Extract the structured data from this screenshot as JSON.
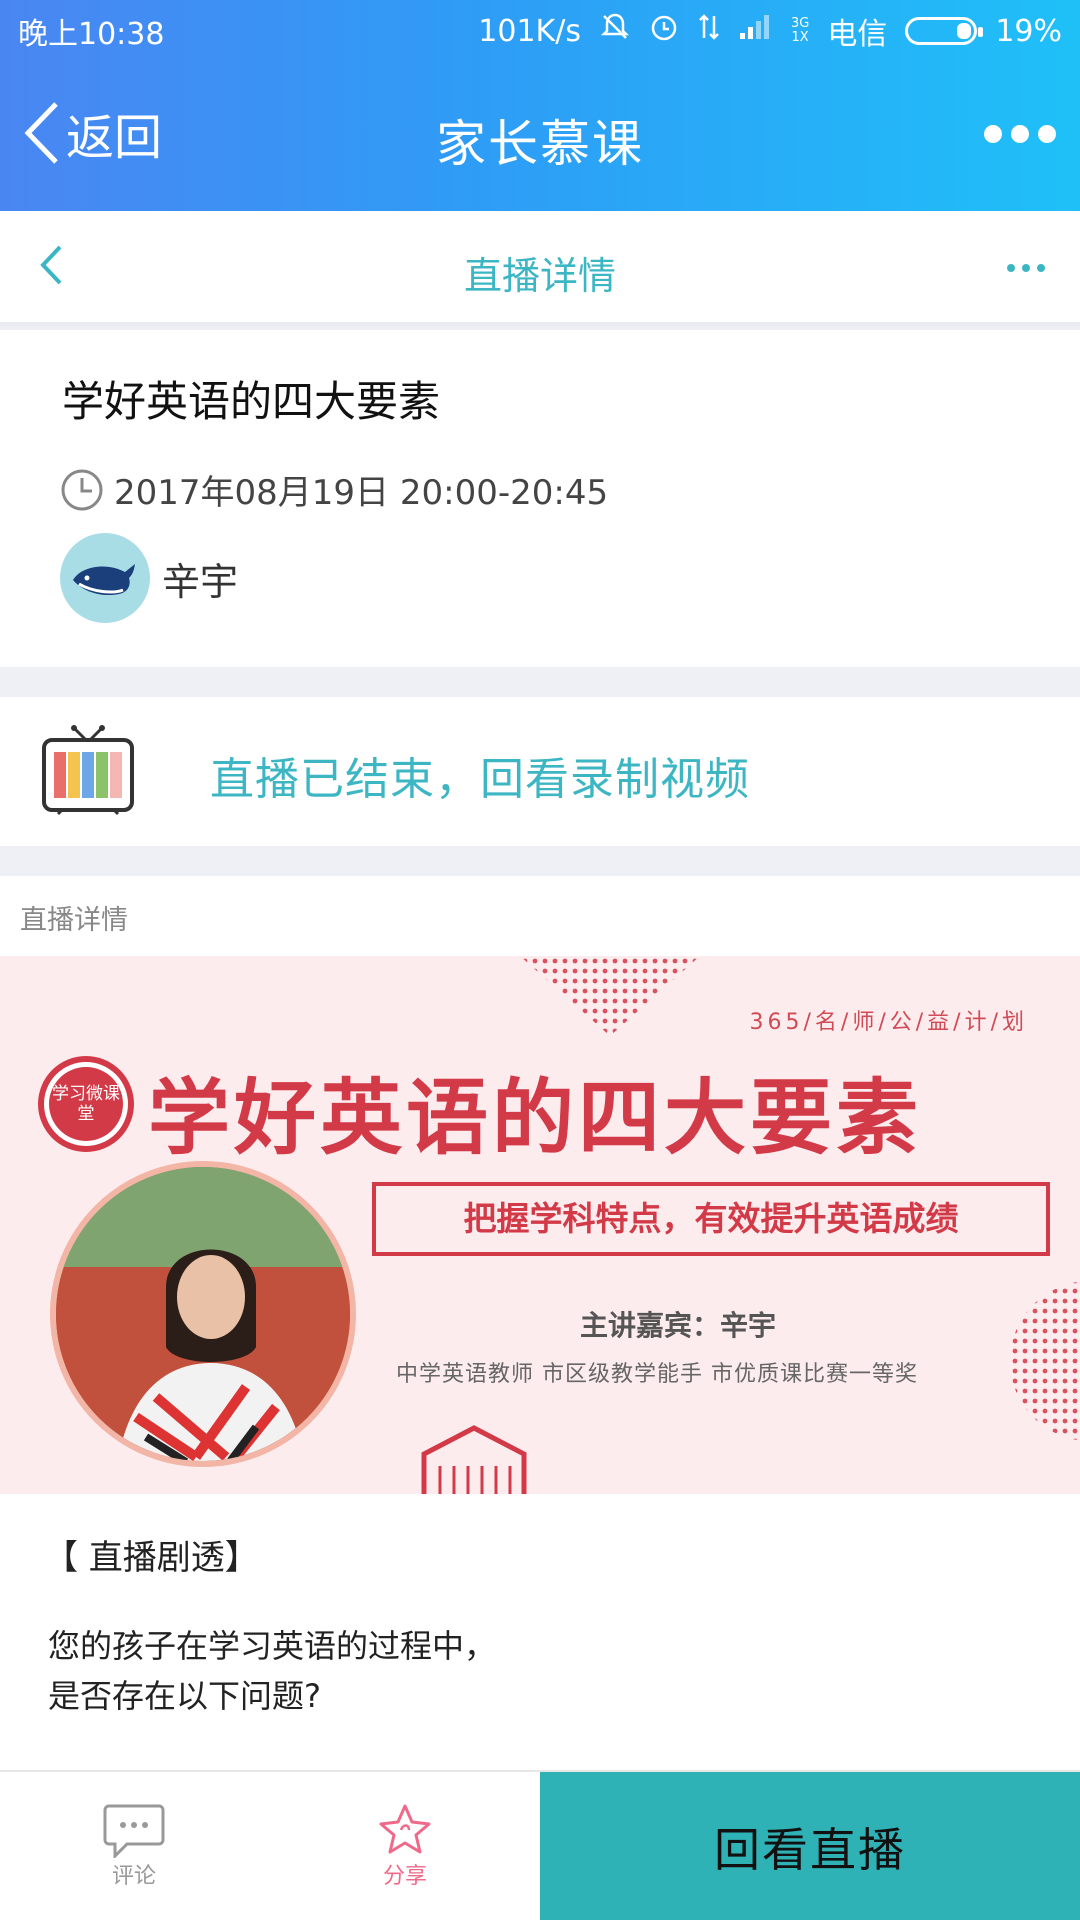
{
  "status_bar": {
    "time": "晚上10:38",
    "speed": "101K/s",
    "network_top": "3G",
    "network_bottom": "1X",
    "carrier": "电信",
    "battery": "19%"
  },
  "app_bar": {
    "back_label": "返回",
    "title": "家长慕课"
  },
  "sub_nav": {
    "title": "直播详情"
  },
  "lesson": {
    "title": "学好英语的四大要素",
    "datetime": "2017年08月19日 20:00-20:45",
    "host_name": "辛宇"
  },
  "live_status": {
    "text": "直播已结束，回看录制视频"
  },
  "detail": {
    "label": "直播详情",
    "banner": {
      "tag": "365/名/师/公/益/计/划",
      "logo_text": "学习微课堂",
      "headline": "学好英语的四大要素",
      "subheadline": "把握学科特点，有效提升英语成绩",
      "speaker": "主讲嘉宾：辛宇",
      "credentials": "中学英语教师  市区级教学能手  市优质课比赛一等奖"
    },
    "section_title": "【 直播剧透】",
    "paragraph_line1": "您的孩子在学习英语的过程中，",
    "paragraph_line2": "是否存在以下问题?"
  },
  "bottom_bar": {
    "comment_label": "评论",
    "share_label": "分享",
    "replay_label": "回看直播"
  },
  "colors": {
    "accent": "#3db6c4",
    "replay_button": "#2fb2b5",
    "banner_red": "#d23a48"
  }
}
